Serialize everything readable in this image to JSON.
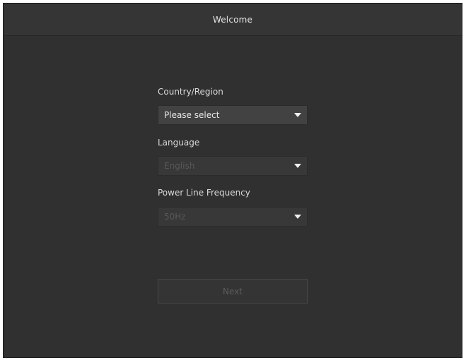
{
  "window": {
    "title": "Welcome"
  },
  "form": {
    "country": {
      "label": "Country/Region",
      "value": "Please select",
      "enabled": true
    },
    "language": {
      "label": "Language",
      "value": "English",
      "enabled": false
    },
    "frequency": {
      "label": "Power Line Frequency",
      "value": "50Hz",
      "enabled": false
    }
  },
  "actions": {
    "next_label": "Next",
    "next_enabled": false
  },
  "icons": {
    "dropdown": "caret-down-icon"
  },
  "colors": {
    "background": "#303030",
    "titlebar": "#353535",
    "select_enabled": "#424242",
    "select_disabled": "#383838",
    "text": "#e6e6e6",
    "text_disabled": "#585858"
  }
}
